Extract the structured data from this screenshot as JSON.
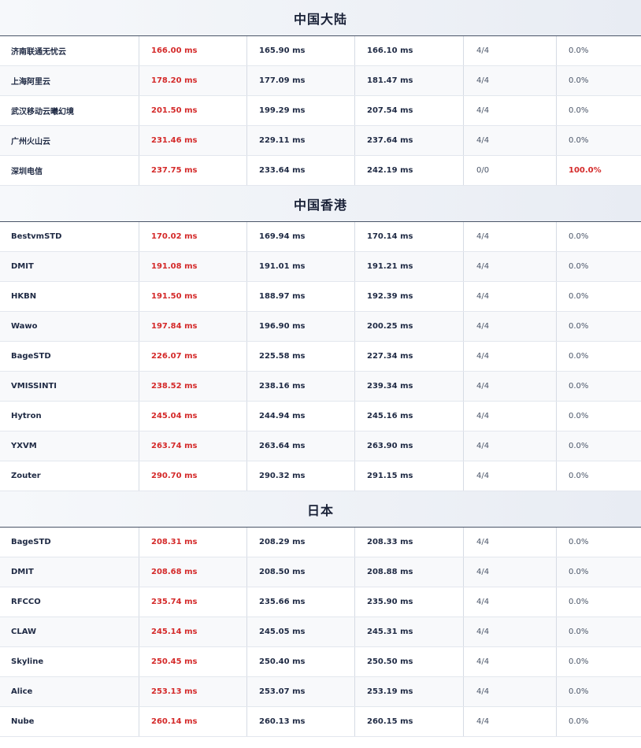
{
  "colors": {
    "accent_red": "#d42a2a",
    "text_dark": "#1f2a44",
    "text_muted": "#4a5568",
    "header_bg": "#e8ecf3"
  },
  "sections": [
    {
      "title": "中国大陆",
      "rows": [
        {
          "name": "济南联通无忧云",
          "avg": "166.00 ms",
          "min": "165.90 ms",
          "max": "166.10 ms",
          "recv": "4/4",
          "loss": "0.0%"
        },
        {
          "name": "上海阿里云",
          "avg": "178.20 ms",
          "min": "177.09 ms",
          "max": "181.47 ms",
          "recv": "4/4",
          "loss": "0.0%"
        },
        {
          "name": "武汉移动云曦幻境",
          "avg": "201.50 ms",
          "min": "199.29 ms",
          "max": "207.54 ms",
          "recv": "4/4",
          "loss": "0.0%"
        },
        {
          "name": "广州火山云",
          "avg": "231.46 ms",
          "min": "229.11 ms",
          "max": "237.64 ms",
          "recv": "4/4",
          "loss": "0.0%"
        },
        {
          "name": "深圳电信",
          "avg": "237.75 ms",
          "min": "233.64 ms",
          "max": "242.19 ms",
          "recv": "0/0",
          "loss": "100.0%"
        }
      ]
    },
    {
      "title": "中国香港",
      "rows": [
        {
          "name": "BestvmSTD",
          "avg": "170.02 ms",
          "min": "169.94 ms",
          "max": "170.14 ms",
          "recv": "4/4",
          "loss": "0.0%"
        },
        {
          "name": "DMIT",
          "avg": "191.08 ms",
          "min": "191.01 ms",
          "max": "191.21 ms",
          "recv": "4/4",
          "loss": "0.0%"
        },
        {
          "name": "HKBN",
          "avg": "191.50 ms",
          "min": "188.97 ms",
          "max": "192.39 ms",
          "recv": "4/4",
          "loss": "0.0%"
        },
        {
          "name": "Wawo",
          "avg": "197.84 ms",
          "min": "196.90 ms",
          "max": "200.25 ms",
          "recv": "4/4",
          "loss": "0.0%"
        },
        {
          "name": "BageSTD",
          "avg": "226.07 ms",
          "min": "225.58 ms",
          "max": "227.34 ms",
          "recv": "4/4",
          "loss": "0.0%"
        },
        {
          "name": "VMISSINTI",
          "avg": "238.52 ms",
          "min": "238.16 ms",
          "max": "239.34 ms",
          "recv": "4/4",
          "loss": "0.0%"
        },
        {
          "name": "Hytron",
          "avg": "245.04 ms",
          "min": "244.94 ms",
          "max": "245.16 ms",
          "recv": "4/4",
          "loss": "0.0%"
        },
        {
          "name": "YXVM",
          "avg": "263.74 ms",
          "min": "263.64 ms",
          "max": "263.90 ms",
          "recv": "4/4",
          "loss": "0.0%"
        },
        {
          "name": "Zouter",
          "avg": "290.70 ms",
          "min": "290.32 ms",
          "max": "291.15 ms",
          "recv": "4/4",
          "loss": "0.0%"
        }
      ]
    },
    {
      "title": "日本",
      "rows": [
        {
          "name": "BageSTD",
          "avg": "208.31 ms",
          "min": "208.29 ms",
          "max": "208.33 ms",
          "recv": "4/4",
          "loss": "0.0%"
        },
        {
          "name": "DMIT",
          "avg": "208.68 ms",
          "min": "208.50 ms",
          "max": "208.88 ms",
          "recv": "4/4",
          "loss": "0.0%"
        },
        {
          "name": "RFCCO",
          "avg": "235.74 ms",
          "min": "235.66 ms",
          "max": "235.90 ms",
          "recv": "4/4",
          "loss": "0.0%"
        },
        {
          "name": "CLAW",
          "avg": "245.14 ms",
          "min": "245.05 ms",
          "max": "245.31 ms",
          "recv": "4/4",
          "loss": "0.0%"
        },
        {
          "name": "Skyline",
          "avg": "250.45 ms",
          "min": "250.40 ms",
          "max": "250.50 ms",
          "recv": "4/4",
          "loss": "0.0%"
        },
        {
          "name": "Alice",
          "avg": "253.13 ms",
          "min": "253.07 ms",
          "max": "253.19 ms",
          "recv": "4/4",
          "loss": "0.0%"
        },
        {
          "name": "Nube",
          "avg": "260.14 ms",
          "min": "260.13 ms",
          "max": "260.15 ms",
          "recv": "4/4",
          "loss": "0.0%"
        }
      ]
    }
  ]
}
